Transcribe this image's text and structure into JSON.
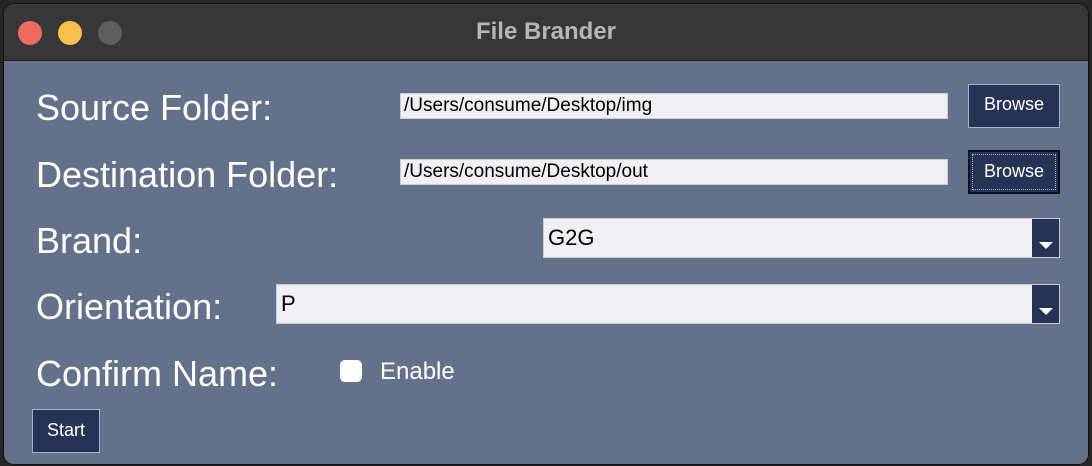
{
  "window": {
    "title": "File Brander"
  },
  "form": {
    "source_folder_label": "Source Folder:",
    "source_folder_value": "/Users/consume/Desktop/img",
    "source_browse_label": "Browse",
    "destination_folder_label": "Destination Folder:",
    "destination_folder_value": "/Users/consume/Desktop/out",
    "destination_browse_label": "Browse",
    "brand_label": "Brand:",
    "brand_value": "G2G",
    "orientation_label": "Orientation:",
    "orientation_value": "P",
    "confirm_name_label": "Confirm Name:",
    "confirm_enable_label": "Enable",
    "confirm_enable_checked": false,
    "start_label": "Start"
  },
  "colors": {
    "window_bg": "#64718b",
    "titlebar_bg": "#373737",
    "button_bg": "#263354",
    "close": "#ed6a5e",
    "minimize": "#f5bf4f",
    "maximize": "#5e5e5e"
  },
  "icons": [
    "close-traffic-light",
    "minimize-traffic-light",
    "maximize-traffic-light",
    "chevron-down-icon"
  ]
}
